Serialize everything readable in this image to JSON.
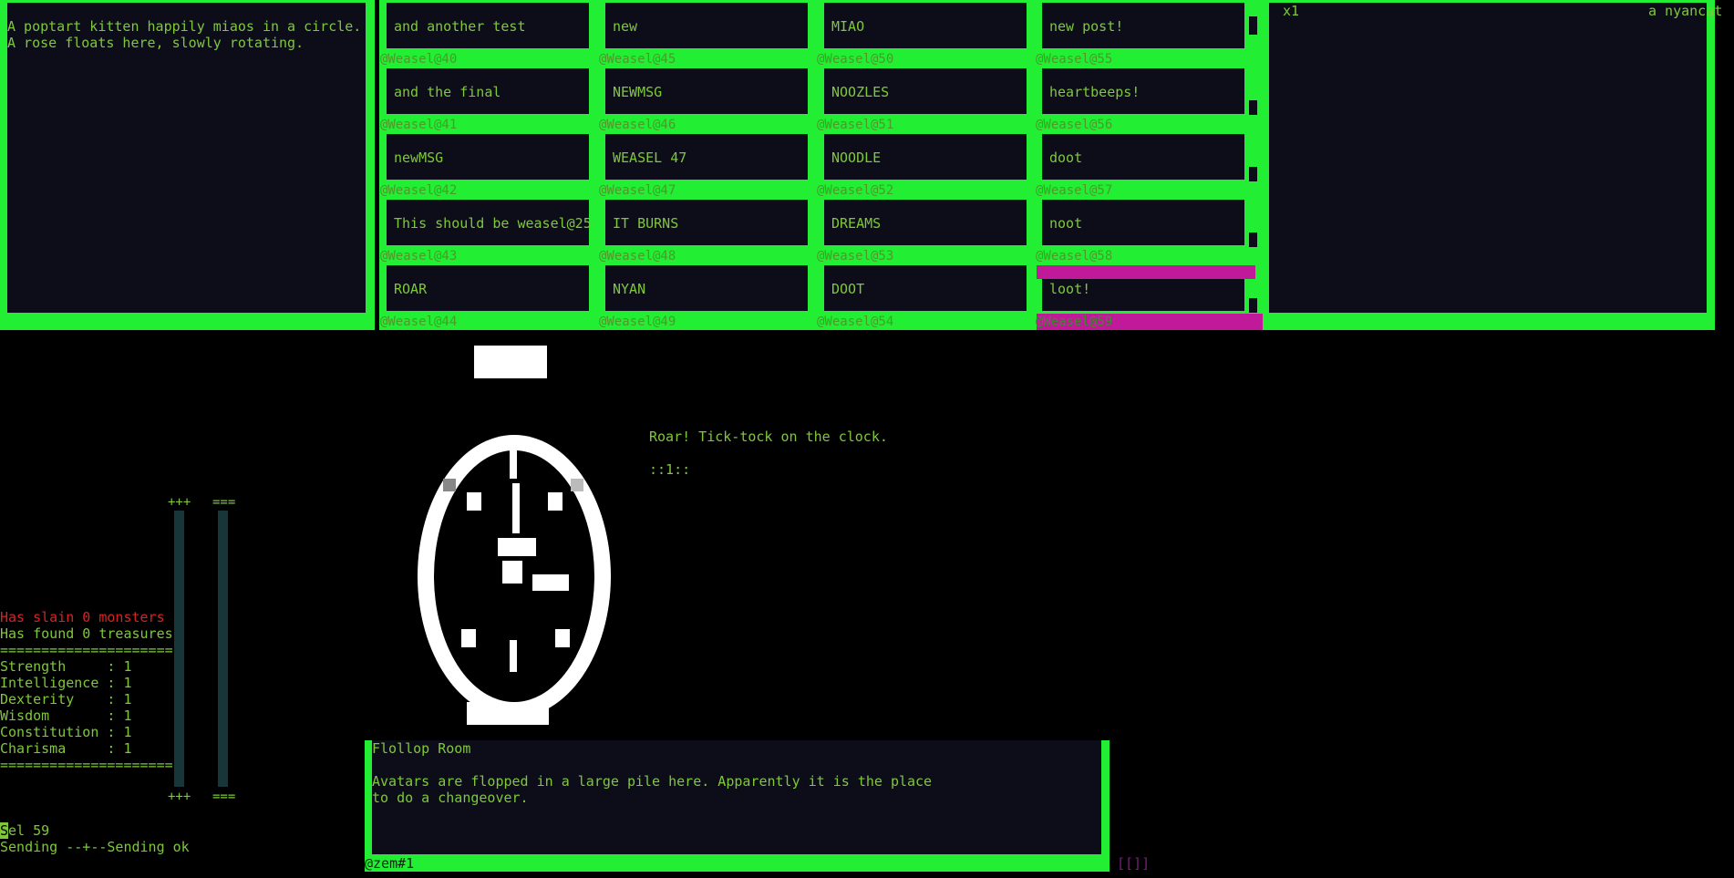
{
  "top_left_pane": {
    "lines": [
      "A poptart kitten happily miaos in a circle.",
      "A rose floats here, slowly rotating."
    ]
  },
  "grid": {
    "columns": [
      {
        "cells": [
          "and another test",
          "and the final",
          "newMSG",
          "This should be weasel@25",
          "ROAR"
        ],
        "labels": [
          "@Weasel@40",
          "@Weasel@41",
          "@Weasel@42",
          "@Weasel@43",
          "@Weasel@44"
        ]
      },
      {
        "cells": [
          "new",
          "NEWMSG",
          "WEASEL 47",
          "IT BURNS",
          "NYAN"
        ],
        "labels": [
          "@Weasel@45",
          "@Weasel@46",
          "@Weasel@47",
          "@Weasel@48",
          "@Weasel@49"
        ]
      },
      {
        "cells": [
          "MIAO",
          "NOOZLES",
          "NOODLE",
          "DREAMS",
          "DOOT"
        ],
        "labels": [
          "@Weasel@50",
          "@Weasel@51",
          "@Weasel@52",
          "@Weasel@53",
          "@Weasel@54"
        ]
      },
      {
        "cells": [
          "new post!",
          "heartbeeps!",
          "doot",
          "noot",
          "loot!"
        ],
        "labels": [
          "@Weasel@55",
          "@Weasel@56",
          "@Weasel@57",
          "@Weasel@58",
          "@Weasel@59"
        ]
      }
    ]
  },
  "top_right_pane": {
    "zoom": "x1",
    "name": "a nyancat"
  },
  "scene": {
    "caption": "Roar! Tick-tock on the clock.",
    "counter": "::1::"
  },
  "gauges": {
    "plus_label": "+++",
    "eq_label": "==="
  },
  "stats": {
    "slain": "Has slain 0 monsters",
    "found": "Has found 0 treasures",
    "divider": "=====================",
    "rows": [
      "Strength     : 1",
      "Intelligence : 1",
      "Dexterity    : 1",
      "Wisdom       : 1",
      "Constitution : 1",
      "Charisma     : 1"
    ]
  },
  "status": {
    "sel_first": "S",
    "sel_rest": "el 59",
    "sending": "Sending --+--Sending ok"
  },
  "room": {
    "title": "Flollop Room",
    "description": "Avatars are flopped in a large pile here. Apparently it is the place\nto do a changeover."
  },
  "input": {
    "prompt": "@zem#1",
    "suffix": "[[]]"
  },
  "colors": {
    "frame": "#22ee33",
    "pane": "#0d0d1a",
    "text": "#7ec83a",
    "selected": "#c0199a",
    "alert": "#d42424"
  }
}
